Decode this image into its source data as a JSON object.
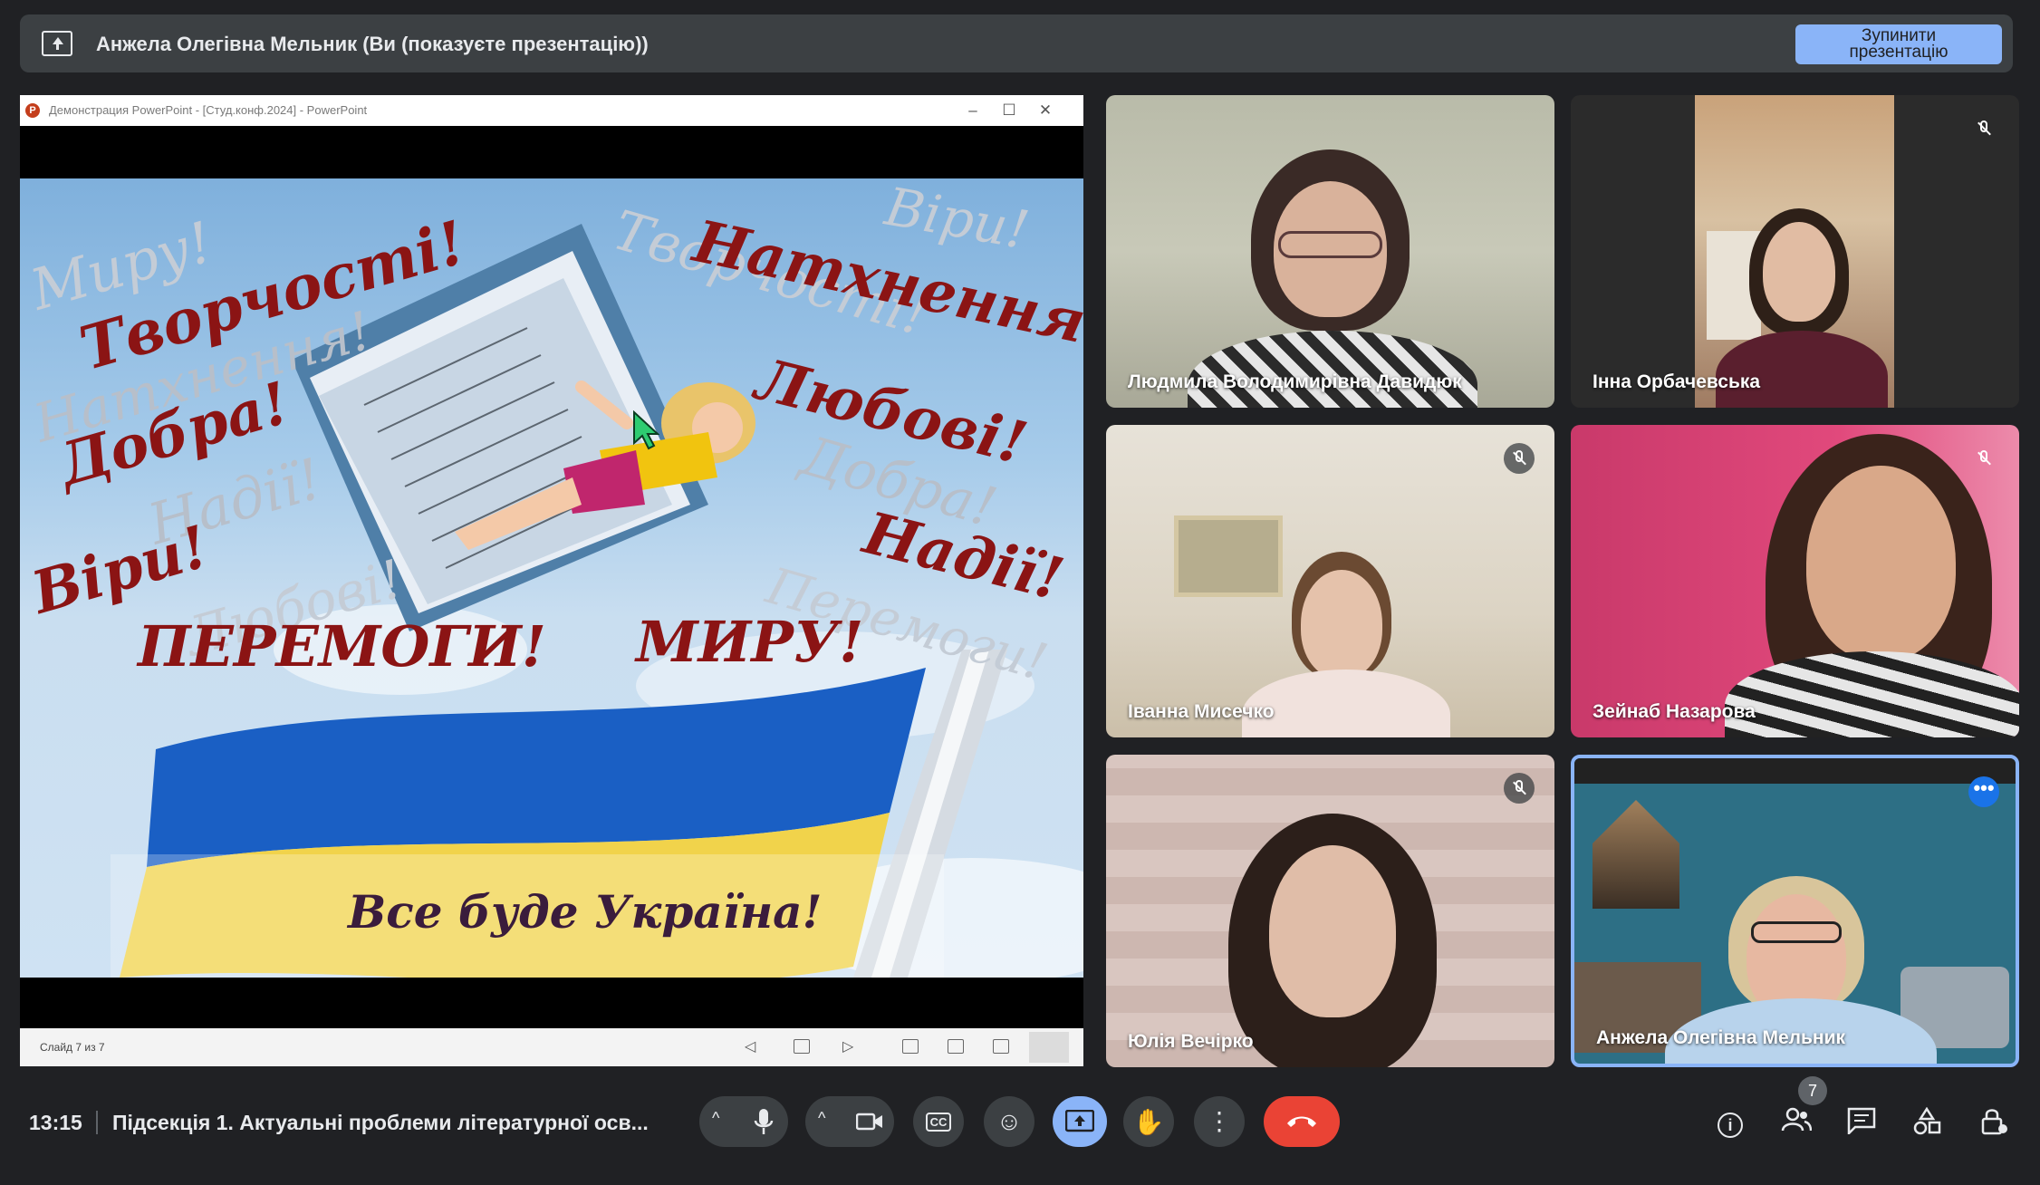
{
  "banner": {
    "title": "Анжела Олегівна Мельник (Ви (показуєте презентацію))",
    "stop_button": "Зупинити презентацію"
  },
  "ppt": {
    "window_title": "Демонстрация PowerPoint - [Студ.конф.2024] - PowerPoint",
    "status": "Слайд 7 из 7",
    "slide": {
      "words_red": [
        "Творчості!",
        "Натхнення!",
        "Любові!",
        "Добра!",
        "Віри!",
        "Надії!",
        "ПЕРЕМОГИ!",
        "МИРУ!"
      ],
      "words_faded": [
        "Миру!",
        "Віри!",
        "Творчості!",
        "Натхнення!",
        "Надії!",
        "Добра!",
        "Любові!",
        "Перемоги!"
      ],
      "caption": "Все буде Україна!"
    }
  },
  "participants": [
    {
      "name": "Людмила Володимирівна Давидюк",
      "muted": false
    },
    {
      "name": "Інна Орбачевська",
      "muted": true
    },
    {
      "name": "Іванна Мисечко",
      "muted": true
    },
    {
      "name": "Зейнаб Назарова",
      "muted": true
    },
    {
      "name": "Юлія Вечірко",
      "muted": true
    },
    {
      "name": "Анжела Олегівна Мельник",
      "muted": false,
      "active": true
    }
  ],
  "bottom": {
    "time": "13:15",
    "meeting_title": "Підсекція 1. Актуальні проблеми літературної осв...",
    "participant_count": "7"
  },
  "colors": {
    "background": "#202124",
    "tile": "#3c4043",
    "accent": "#8ab4f8",
    "end_call": "#ea4335"
  }
}
